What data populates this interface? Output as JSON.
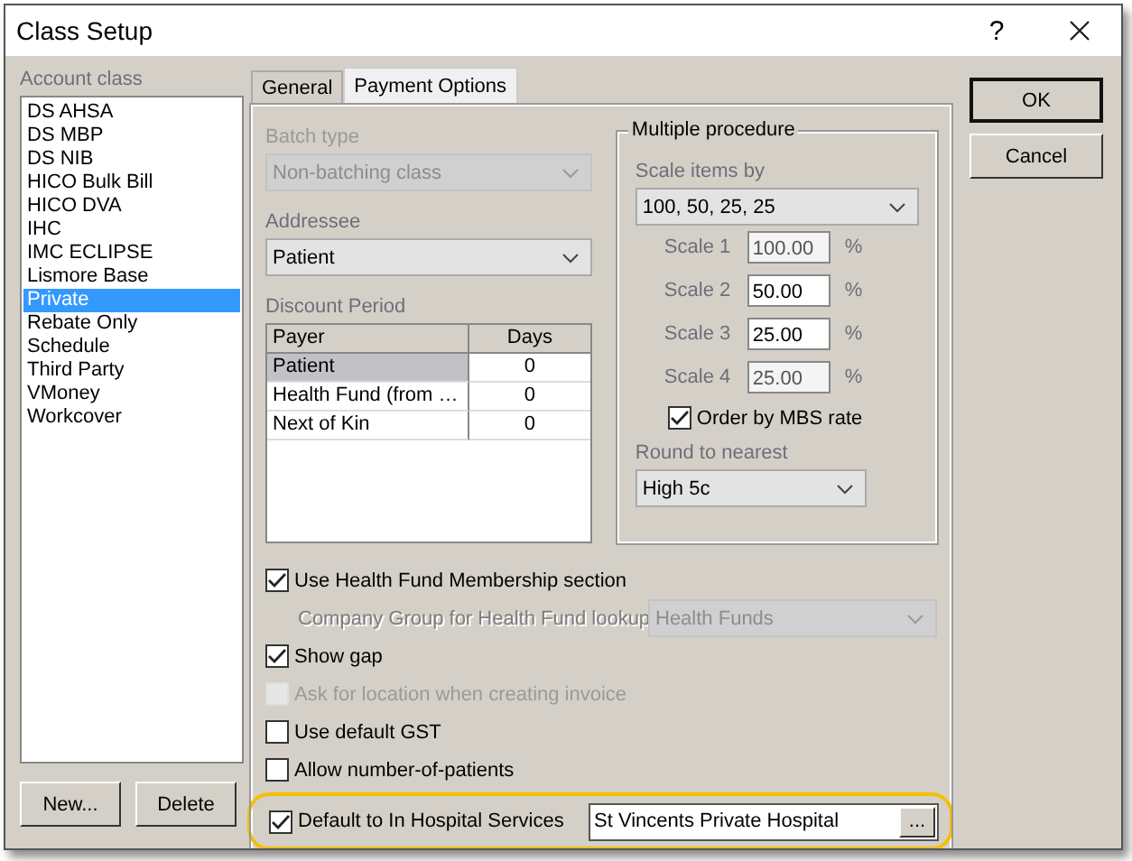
{
  "window": {
    "title": "Class Setup",
    "help": "?"
  },
  "account_class": {
    "label": "Account class",
    "items": [
      {
        "label": "DS AHSA",
        "selected": false
      },
      {
        "label": "DS MBP",
        "selected": false
      },
      {
        "label": "DS NIB",
        "selected": false
      },
      {
        "label": "HICO Bulk Bill",
        "selected": false
      },
      {
        "label": "HICO DVA",
        "selected": false
      },
      {
        "label": "IHC",
        "selected": false
      },
      {
        "label": "IMC ECLIPSE",
        "selected": false
      },
      {
        "label": "Lismore Base",
        "selected": false
      },
      {
        "label": "Private",
        "selected": true
      },
      {
        "label": "Rebate Only",
        "selected": false
      },
      {
        "label": "Schedule",
        "selected": false
      },
      {
        "label": "Third Party",
        "selected": false
      },
      {
        "label": "VMoney",
        "selected": false
      },
      {
        "label": "Workcover",
        "selected": false
      }
    ],
    "buttons": [
      "New...",
      "Delete"
    ]
  },
  "tabs": [
    {
      "label": "General",
      "selected": false
    },
    {
      "label": "Payment Options",
      "selected": true
    }
  ],
  "batch_type": {
    "label": "Batch type",
    "value": "Non-batching class",
    "disabled": true
  },
  "addressee": {
    "label": "Addressee",
    "value": "Patient",
    "disabled": false
  },
  "discount_period": {
    "label": "Discount Period",
    "columns": [
      "Payer",
      "Days"
    ],
    "rows": [
      {
        "payer": "Patient",
        "days": "0",
        "selected": true
      },
      {
        "payer": "Health Fund (from …",
        "days": "0",
        "selected": false
      },
      {
        "payer": "Next of Kin",
        "days": "0",
        "selected": false
      }
    ]
  },
  "multiple_procedure": {
    "title": "Multiple procedure",
    "scale_label": "Scale items by",
    "scale_value": "100, 50, 25, 25",
    "scales": [
      {
        "label": "Scale 1",
        "value": "100.00",
        "unit": "%",
        "disabled": true
      },
      {
        "label": "Scale 2",
        "value": "50.00",
        "unit": "%",
        "disabled": false
      },
      {
        "label": "Scale 3",
        "value": "25.00",
        "unit": "%",
        "disabled": false
      },
      {
        "label": "Scale 4",
        "value": "25.00",
        "unit": "%",
        "disabled": true
      }
    ],
    "order_by_mbs": {
      "label": "Order by MBS rate",
      "checked": true
    },
    "round_label": "Round to nearest",
    "round_value": "High 5c"
  },
  "options": [
    {
      "kind": "checkbox",
      "label": "Use Health Fund Membership section",
      "checked": true,
      "disabled": false
    },
    {
      "kind": "select",
      "label": "Company Group for Health Fund lookup",
      "value": "Health Funds",
      "disabled": true
    },
    {
      "kind": "checkbox",
      "label": "Show gap",
      "checked": true,
      "disabled": false
    },
    {
      "kind": "checkbox",
      "label": "Ask for location when creating invoice",
      "checked": false,
      "disabled": true
    },
    {
      "kind": "checkbox",
      "label": "Use default GST",
      "checked": false,
      "disabled": false
    },
    {
      "kind": "checkbox",
      "label": "Allow number-of-patients",
      "checked": false,
      "disabled": false
    },
    {
      "kind": "checkbox_field",
      "label": "Default to In Hospital Services",
      "checked": true,
      "disabled": false,
      "value": "St Vincents Private Hospital",
      "button": "...",
      "highlighted": true
    }
  ],
  "dialog_buttons": [
    {
      "label": "OK",
      "default": true
    },
    {
      "label": "Cancel",
      "default": false
    }
  ]
}
